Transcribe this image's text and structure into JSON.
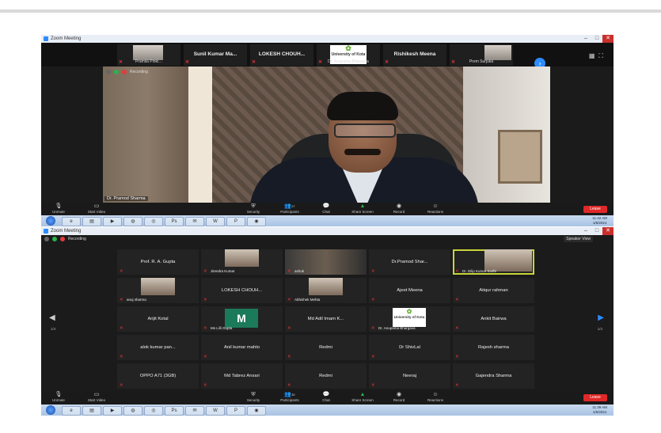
{
  "window_title": "Zoom Meeting",
  "recording_label": "Recording",
  "speaker_view_label": "Speaker View",
  "strip": [
    {
      "name": "",
      "sub": "Pramila Pinki…",
      "video": true
    },
    {
      "name": "Sunil Kumar Ma...",
      "sub": ""
    },
    {
      "name": "LOKESH CHOUH...",
      "sub": ""
    },
    {
      "name": "",
      "sub": "Dr. Anupama Bhargava",
      "logo": "University of Kota"
    },
    {
      "name": "Rishikesh Meena",
      "sub": ""
    },
    {
      "name": "",
      "sub": "Prem Surjuka",
      "video": true
    }
  ],
  "active_speaker_name": "Dr. Pramod Sharma",
  "toolbar": {
    "unmute": "Unmute",
    "start_video": "Start Video",
    "security": "Security",
    "participants": "Participants",
    "participants_count_1": "27",
    "participants_count_2": "30",
    "chat": "Chat",
    "share_screen": "Share Screen",
    "record": "Record",
    "reactions": "Reactions",
    "leave": "Leave"
  },
  "clock_1": {
    "time": "11:42 AM",
    "date": "1/5/2021"
  },
  "clock_2": {
    "time": "11:39 AM",
    "date": "1/5/2021"
  },
  "grid": [
    {
      "name": "Prof. R. A. Gupta"
    },
    {
      "name": "",
      "sub": "Jitendra Kumar",
      "video": true
    },
    {
      "name": "",
      "sub": "ashok",
      "video": "dark"
    },
    {
      "name": "Dr.Pramod Shar..."
    },
    {
      "name": "",
      "sub": "Dr. Dilip Kumar Sodhi",
      "video": true,
      "highlight": true
    },
    {
      "name": "",
      "sub": "anuj sharma",
      "video": true
    },
    {
      "name": "LOKESH CHOUH..."
    },
    {
      "name": "",
      "sub": "Abhishek Mehta",
      "video": true
    },
    {
      "name": "Ajeet Meena"
    },
    {
      "name": "Atiqur rahman"
    },
    {
      "name": "Arijit Kotal"
    },
    {
      "name": "",
      "sub": "Ms Lilli Gupta",
      "initial": "M"
    },
    {
      "name": "Md Adil Imam K..."
    },
    {
      "name": "",
      "sub": "Dr. Anupama Bhargava",
      "logo": "University of Kota"
    },
    {
      "name": "Ankit Bairwa"
    },
    {
      "name": "alok kumar pan..."
    },
    {
      "name": "Anil kumar mahto"
    },
    {
      "name": "Redmi"
    },
    {
      "name": "Dr ShivLal"
    },
    {
      "name": "Rajesh sharma"
    },
    {
      "name": "OPPO A71 (3GB)"
    },
    {
      "name": "Md Tabrez Ansari"
    },
    {
      "name": "Redmi"
    },
    {
      "name": "Neeraj"
    },
    {
      "name": "Gajendra Sharma"
    }
  ],
  "page_indicator_left": "1/4",
  "page_indicator_right": "1/4"
}
